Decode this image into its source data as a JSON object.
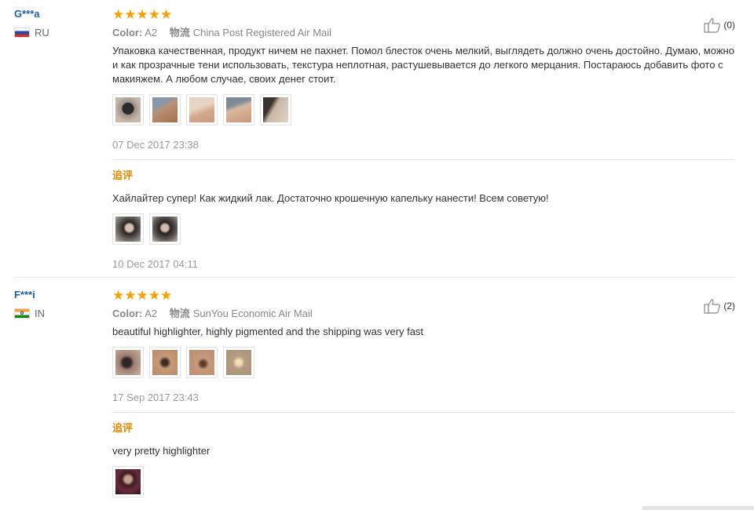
{
  "reviews": [
    {
      "user": "G***a",
      "country": "RU",
      "stars": "★★★★★",
      "color_label": "Color:",
      "color_value": "A2",
      "shipping_label": "物流",
      "shipping_value": "China Post Registered Air Mail",
      "likes": "(0)",
      "text": "Упаковка качественная, продукт ничем не пахнет. Помол блесток очень мелкий, выглядеть должно очень достойно. Думаю, можно и как прозрачные тени использовать, текстура неплотная, растушевывается до легкого мерцания. Постараюсь добавить фото с макияжем. А любом случае, своих денег стоит.",
      "date": "07 Dec 2017 23:38",
      "followup_title": "追评",
      "followup_text": "Хайлайтер супер! Как жидкий лак. Достаточно крошечную капельку нанести! Всем советую!",
      "followup_date": "10 Dec 2017 04:11"
    },
    {
      "user": "F***i",
      "country": "IN",
      "stars": "★★★★★",
      "color_label": "Color:",
      "color_value": "A2",
      "shipping_label": "物流",
      "shipping_value": "SunYou Economic Air Mail",
      "likes": "(2)",
      "text": "beautiful highlighter, highly pigmented and the shipping was very fast",
      "date": "17 Sep 2017 23:43",
      "followup_title": "追评",
      "followup_text": "very pretty highlighter"
    }
  ],
  "icons": {
    "like": "thumbs-up-icon",
    "star": "star-icon",
    "flag_ru": "russia-flag-icon",
    "flag_in": "india-flag-icon"
  },
  "colors": {
    "user_link": "#1a5fb4",
    "stars": "#f7a000",
    "followup_title": "#e58a00"
  }
}
